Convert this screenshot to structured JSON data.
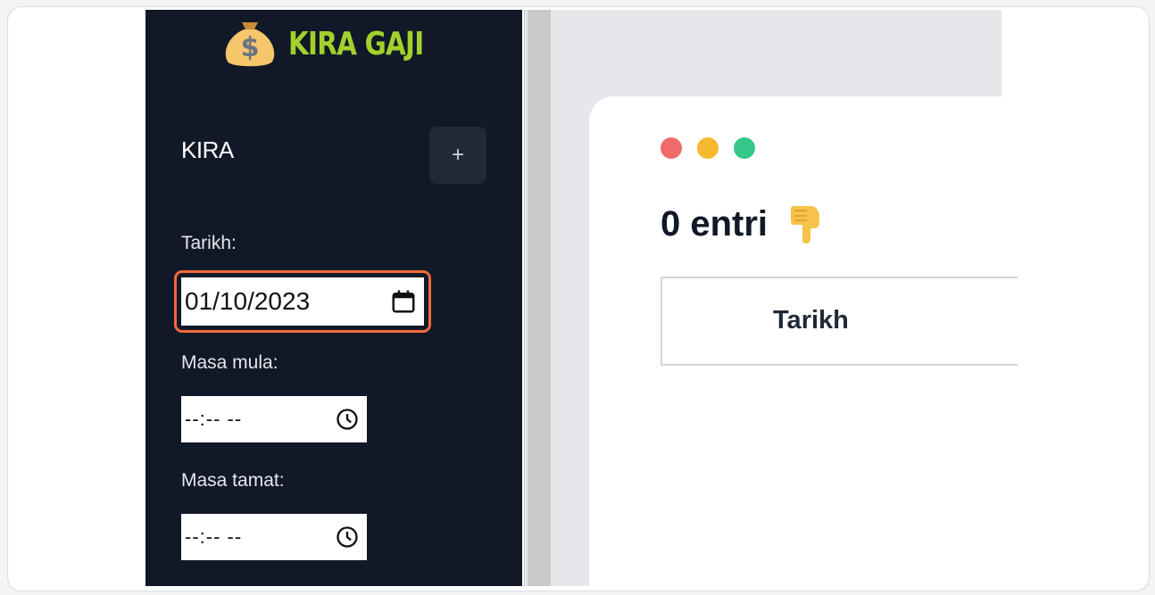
{
  "app": {
    "logo_text": "KIRA GAJI",
    "logo_icon": "money-bag-icon",
    "colors": {
      "sidebar_bg": "#111827",
      "logo_green": "#a3d12c",
      "focus_orange": "#f46a3b"
    }
  },
  "sidebar": {
    "section_title": "KIRA",
    "add_button_label": "+",
    "date_label": "Tarikh:",
    "date_value": "01/10/2023",
    "start_label": "Masa mula:",
    "start_value": "--:-- --",
    "end_label": "Masa tamat:",
    "end_value": "--:-- --"
  },
  "main": {
    "window_dots": [
      "#ef6b6b",
      "#f5b82e",
      "#34c98a"
    ],
    "entry_count_text": "0 entri",
    "pointing_icon": "pointing-down-hand-icon",
    "table_headers": [
      "Tarikh"
    ]
  }
}
